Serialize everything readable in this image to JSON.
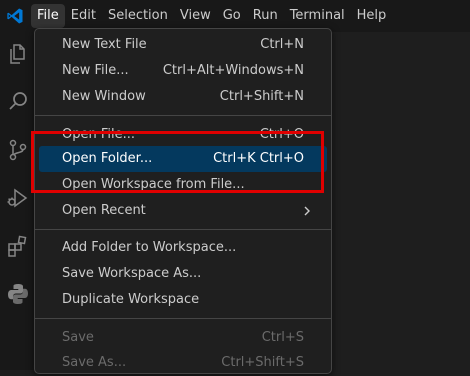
{
  "menubar": {
    "items": [
      "File",
      "Edit",
      "Selection",
      "View",
      "Go",
      "Run",
      "Terminal",
      "Help"
    ],
    "active": "File"
  },
  "activity_icons": [
    "explorer-icon",
    "search-icon",
    "source-control-icon",
    "run-debug-icon",
    "extensions-icon",
    "python-icon"
  ],
  "file_menu": {
    "new_text_file": {
      "label": "New Text File",
      "shortcut": "Ctrl+N"
    },
    "new_file": {
      "label": "New File...",
      "shortcut": "Ctrl+Alt+Windows+N"
    },
    "new_window": {
      "label": "New Window",
      "shortcut": "Ctrl+Shift+N"
    },
    "open_file": {
      "label": "Open File...",
      "shortcut": "Ctrl+O"
    },
    "open_folder": {
      "label": "Open Folder...",
      "shortcut": "Ctrl+K Ctrl+O"
    },
    "open_workspace": {
      "label": "Open Workspace from File..."
    },
    "open_recent": {
      "label": "Open Recent"
    },
    "add_folder": {
      "label": "Add Folder to Workspace..."
    },
    "save_workspace_as": {
      "label": "Save Workspace As..."
    },
    "duplicate_workspace": {
      "label": "Duplicate Workspace"
    },
    "save": {
      "label": "Save",
      "shortcut": "Ctrl+S",
      "disabled": true
    },
    "save_as": {
      "label": "Save As...",
      "shortcut": "Ctrl+Shift+S",
      "disabled": true
    }
  },
  "colors": {
    "highlight": "#04395e",
    "annotation_box": "#e00000",
    "vscode_blue": "#0078d4"
  }
}
